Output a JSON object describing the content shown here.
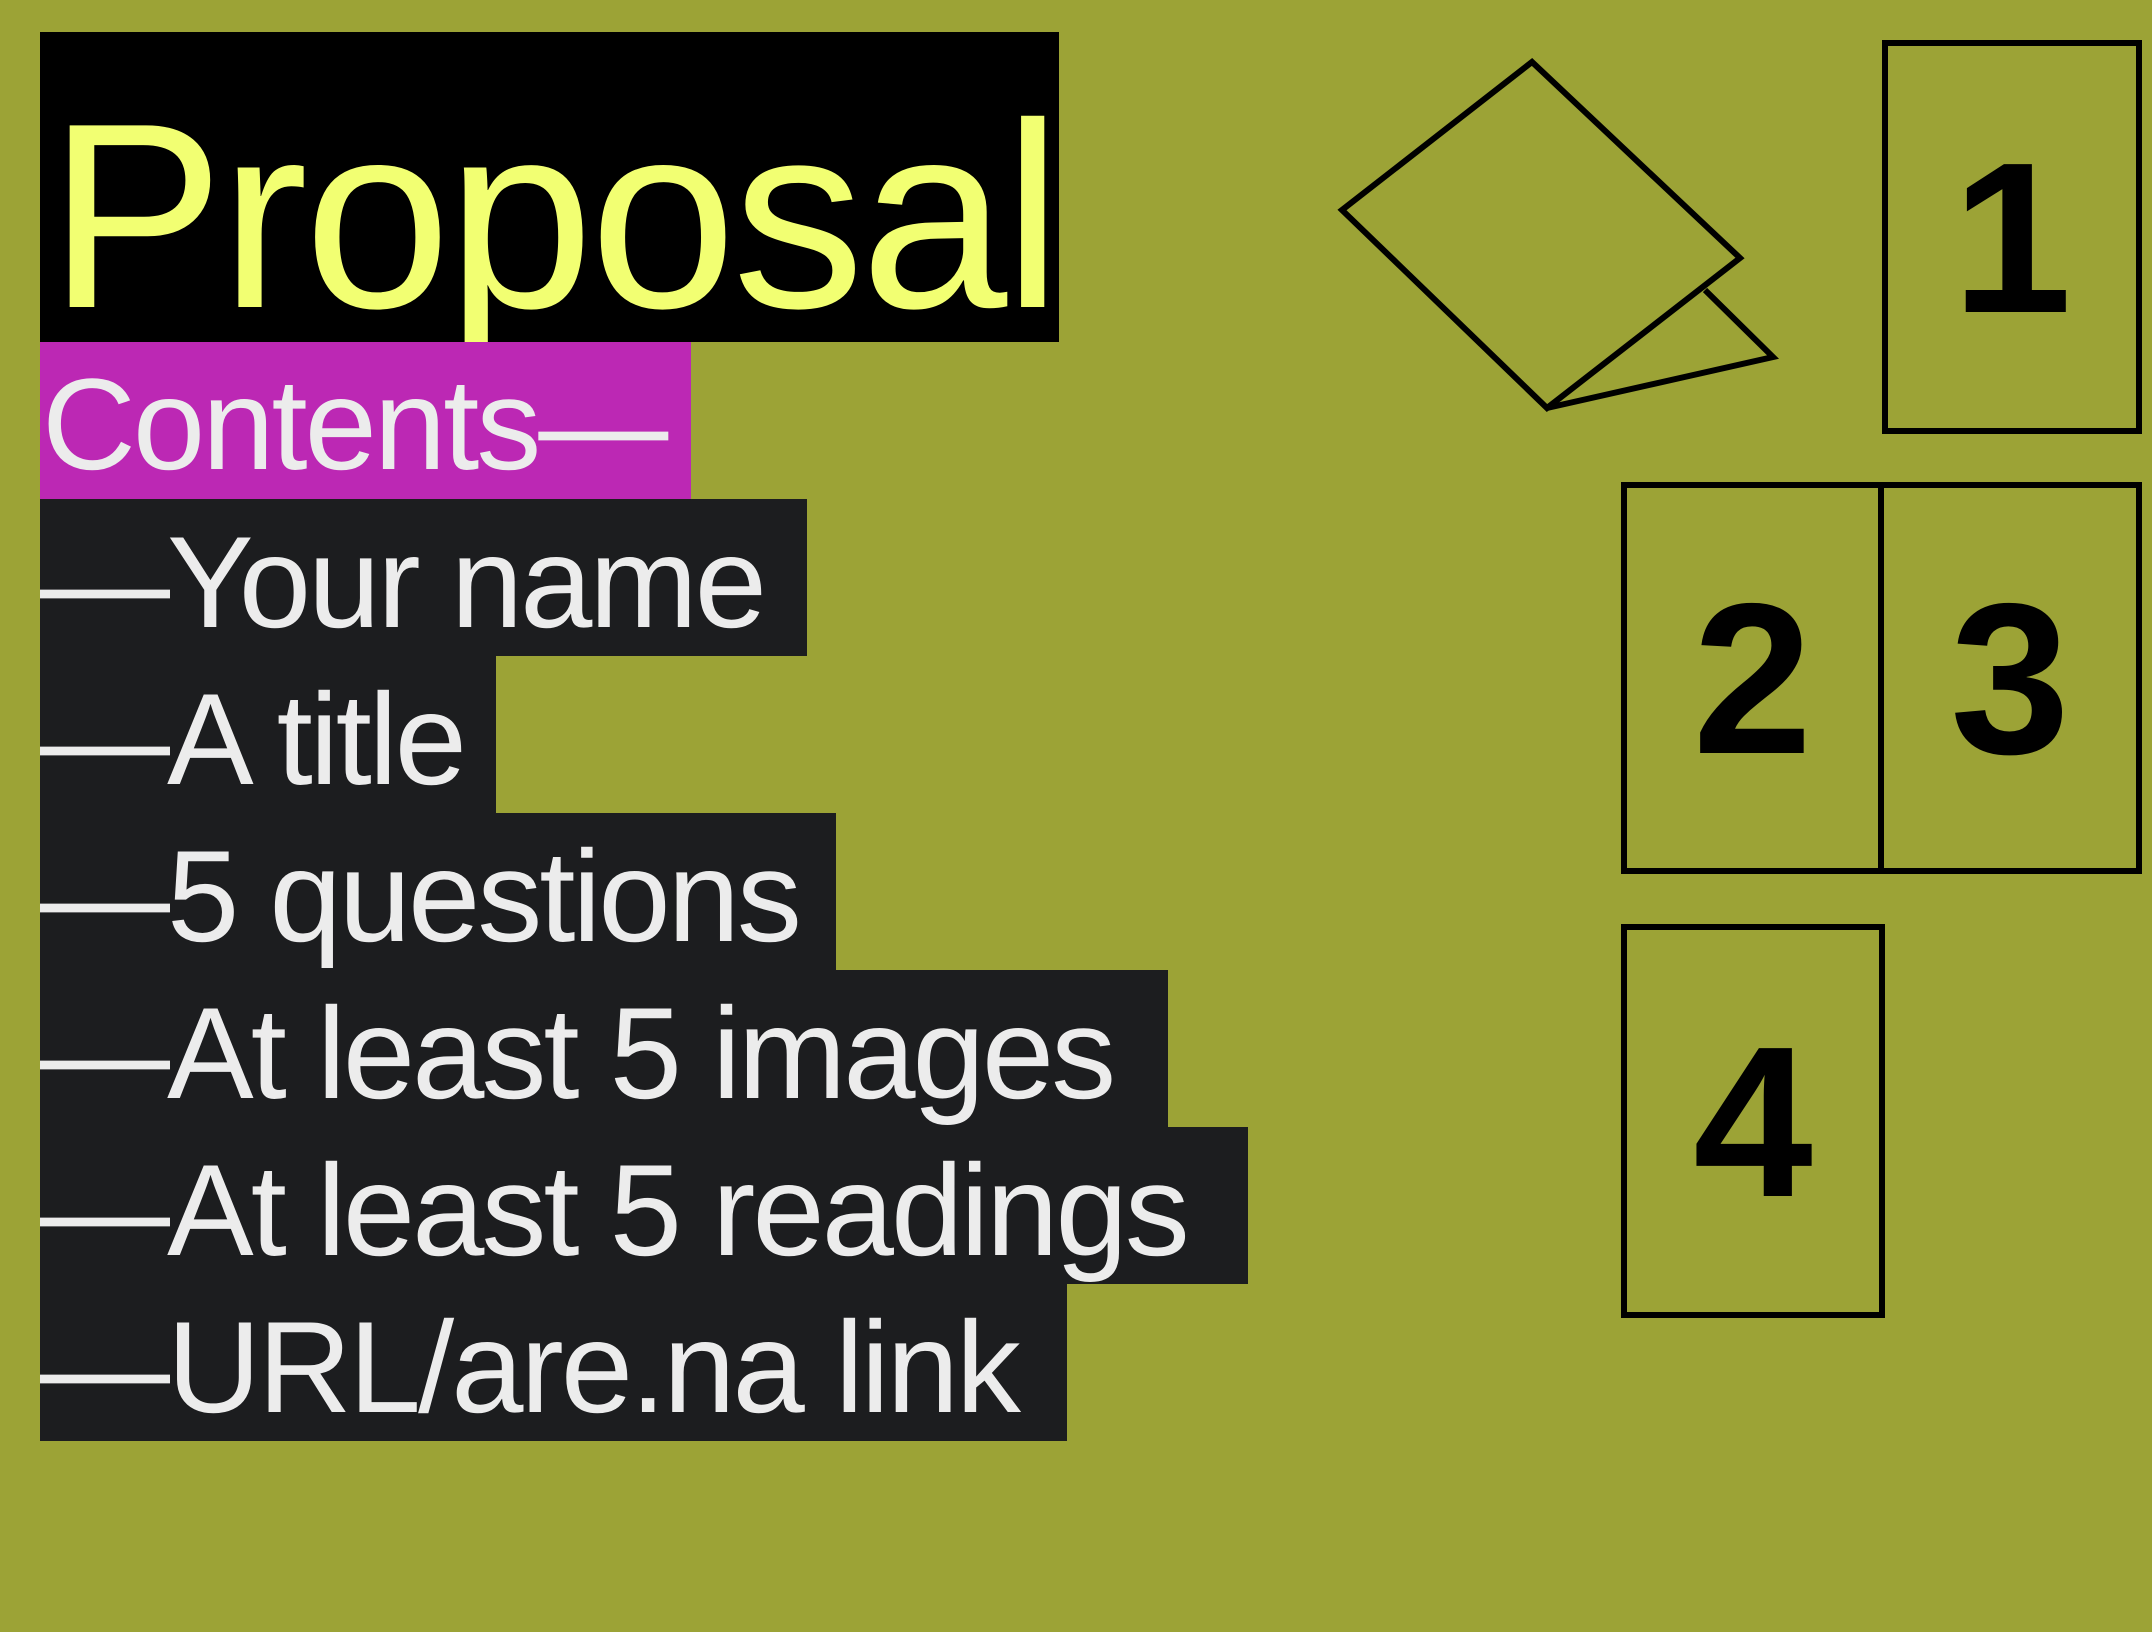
{
  "title": "Proposal",
  "contents_heading": "Contents—",
  "items": [
    "—Your name",
    "—A title",
    "—5 questions",
    "—At least 5 images",
    "—At least 5 readings",
    "—URL/are.na link"
  ],
  "page_boxes": [
    "1",
    "2",
    "3",
    "4"
  ],
  "colors": {
    "background": "#9ca336",
    "title_bg": "#000000",
    "title_text": "#f2ff72",
    "contents_bg": "#bc28b4",
    "item_bg": "#1c1d1f",
    "item_text": "#ececec"
  },
  "icons": {
    "fold": "folded-paper-icon"
  }
}
